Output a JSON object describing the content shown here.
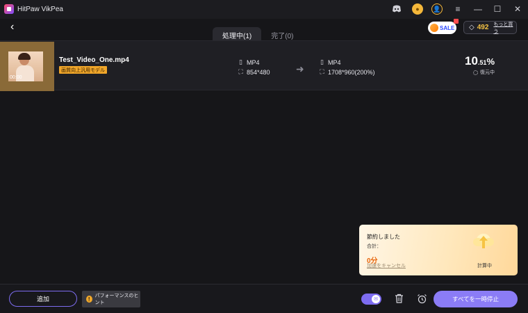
{
  "window": {
    "title": "HitPaw VikPea",
    "controls": {
      "menu": "≡",
      "minimize": "—",
      "maximize": "☐",
      "close": "✕"
    }
  },
  "header": {
    "tabs": [
      {
        "label": "処理中(1)",
        "active": true
      },
      {
        "label": "完了(0)",
        "active": false
      }
    ],
    "sale_label": "SALE",
    "credits": {
      "count": "492",
      "buy_more": "もっと買う"
    }
  },
  "task": {
    "thumbnail_time": "00:00",
    "file_name": "Test_Video_One.mp4",
    "model_tag": "画質向上汎用モデル",
    "source": {
      "format": "MP4",
      "resolution": "854*480"
    },
    "target": {
      "format": "MP4",
      "resolution": "1708*960(200%)"
    },
    "progress": {
      "whole": "10",
      "fraction": ".51",
      "unit": "%",
      "value": 10.51,
      "status": "復元中"
    }
  },
  "savings": {
    "title": "節約しました",
    "total_label": "合計：",
    "value": "0分",
    "cancel_link": "加速をキャンセル",
    "status": "計算中"
  },
  "bottom": {
    "add_label": "追加",
    "tips_label": "パフォーマンスのヒント",
    "pause_all_label": "すべてを一時停止"
  },
  "colors": {
    "accent": "#8b7cf6",
    "tag": "#f0a62a",
    "credit": "#f6c343",
    "savings_value": "#e8670f"
  }
}
